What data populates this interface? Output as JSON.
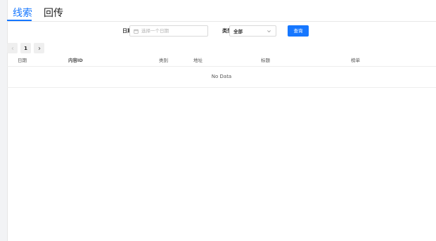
{
  "tabs": [
    {
      "label": "线索",
      "active": true
    },
    {
      "label": "回传",
      "active": false
    }
  ],
  "filters": {
    "date_label": "日期",
    "date_placeholder": "选择一个日期",
    "type_label": "类型",
    "type_value": "全部",
    "query_button": "查询"
  },
  "pagination": {
    "current_page": "1"
  },
  "table": {
    "columns": [
      "日期",
      "内容ID",
      "类别",
      "地址",
      "标题",
      "榜单"
    ],
    "empty_text": "No Data"
  },
  "colors": {
    "accent": "#1677ff"
  },
  "icons": [
    "calendar-icon",
    "chevron-down-icon",
    "chevron-left-icon",
    "chevron-right-icon"
  ]
}
